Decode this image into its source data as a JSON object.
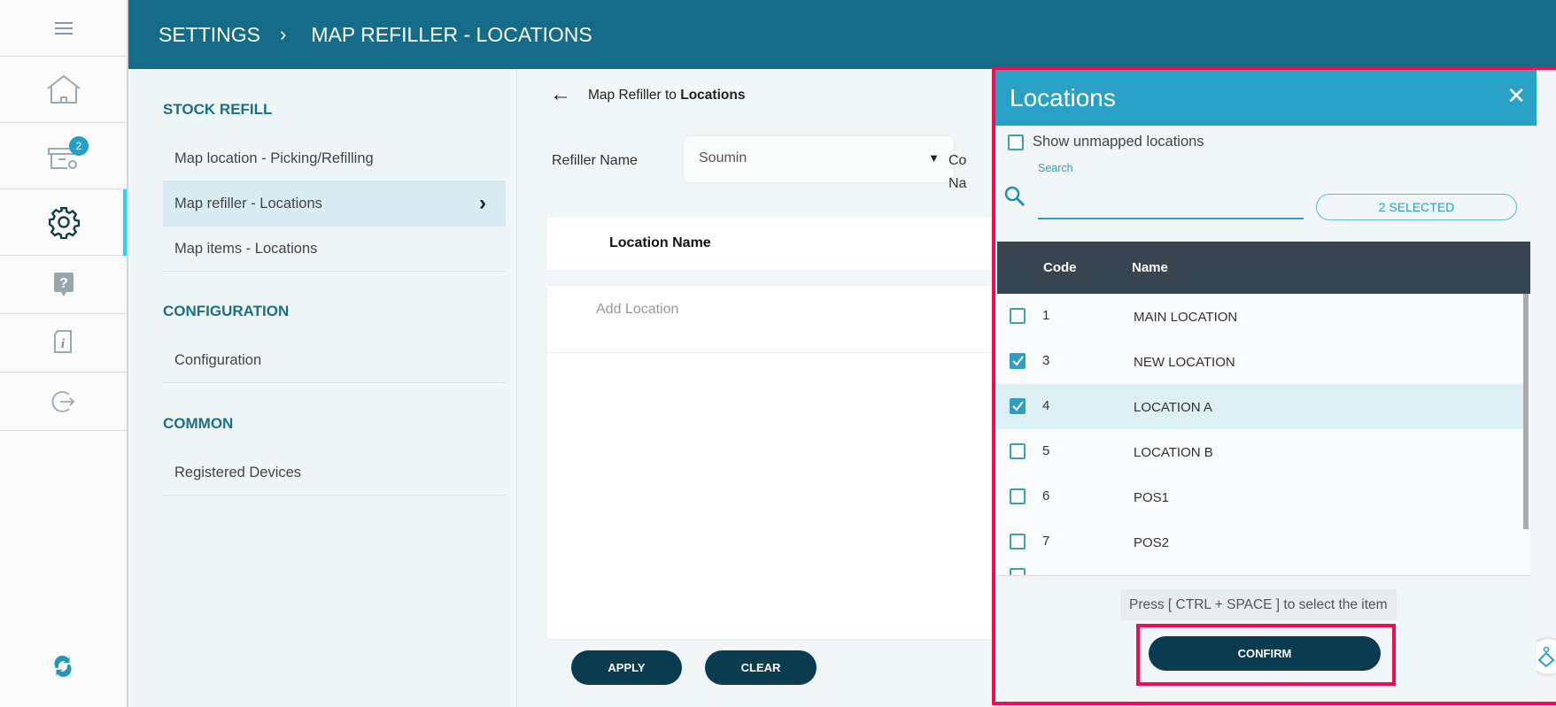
{
  "rail": {
    "badge_count": "2",
    "items": [
      "menu",
      "home",
      "orders",
      "settings",
      "help",
      "info",
      "logout"
    ]
  },
  "header": {
    "crumb_root": "SETTINGS",
    "crumb_sep": "›",
    "crumb_current": "MAP REFILLER - LOCATIONS"
  },
  "settings_nav": {
    "sections": [
      {
        "title": "STOCK REFILL",
        "items": [
          "Map location - Picking/Refilling",
          "Map refiller - Locations",
          "Map items - Locations"
        ]
      },
      {
        "title": "CONFIGURATION",
        "items": [
          "Configuration"
        ]
      },
      {
        "title": "COMMON",
        "items": [
          "Registered Devices"
        ]
      }
    ],
    "active_chevron": "›"
  },
  "main": {
    "back_icon": "←",
    "title_prefix": "Map Refiller to ",
    "title_bold": "Locations",
    "refiller_label": "Refiller Name",
    "refiller_value": "Soumin",
    "dropdown_arrow": "▼",
    "clipped_label_1": "Co",
    "clipped_label_2": "Na",
    "table_header": "Location Name",
    "add_location_placeholder": "Add Location",
    "apply": "APPLY",
    "clear": "CLEAR"
  },
  "modal": {
    "title": "Locations",
    "close": "✕",
    "show_unmapped": "Show unmapped locations",
    "show_unmapped_checked": false,
    "search_label": "Search",
    "search_value": "",
    "selected_badge": "2 SELECTED",
    "columns": [
      "Code",
      "Name"
    ],
    "rows": [
      {
        "code": "1",
        "name": "MAIN LOCATION",
        "checked": false
      },
      {
        "code": "3",
        "name": "NEW LOCATION",
        "checked": true
      },
      {
        "code": "4",
        "name": "LOCATION A",
        "checked": true
      },
      {
        "code": "5",
        "name": "LOCATION B",
        "checked": false
      },
      {
        "code": "6",
        "name": "POS1",
        "checked": false
      },
      {
        "code": "7",
        "name": "POS2",
        "checked": false
      }
    ],
    "hint": "Press [ CTRL + SPACE ] to select the item",
    "confirm": "CONFIRM"
  },
  "colors": {
    "header": "#146c88",
    "modal_header": "#29a1c7",
    "highlight": "#f7094f",
    "button": "#0b3b4f"
  }
}
